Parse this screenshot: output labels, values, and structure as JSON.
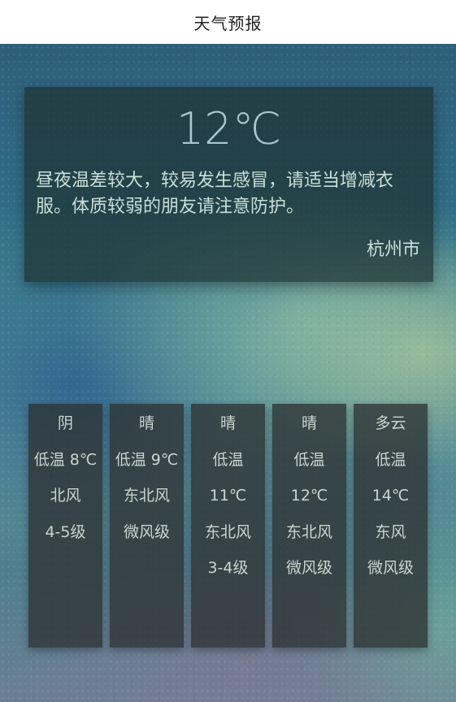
{
  "header": {
    "title": "天气预报"
  },
  "current": {
    "temperature": "12℃",
    "tip": "昼夜温差较大，较易发生感冒，请适当增减衣服。体质较弱的朋友请注意防护。",
    "city": "杭州市"
  },
  "forecast": [
    {
      "weather": "阴",
      "lines": [
        "低温 8℃",
        "北风",
        "4-5级"
      ]
    },
    {
      "weather": "晴",
      "lines": [
        "低温 9℃",
        "东北风",
        "微风级"
      ]
    },
    {
      "weather": "晴",
      "lines": [
        "低温",
        "11℃",
        "东北风",
        "3-4级"
      ]
    },
    {
      "weather": "晴",
      "lines": [
        "低温",
        "12℃",
        "东北风",
        "微风级"
      ]
    },
    {
      "weather": "多云",
      "lines": [
        "低温",
        "14℃",
        "东风",
        "微风级"
      ]
    }
  ]
}
